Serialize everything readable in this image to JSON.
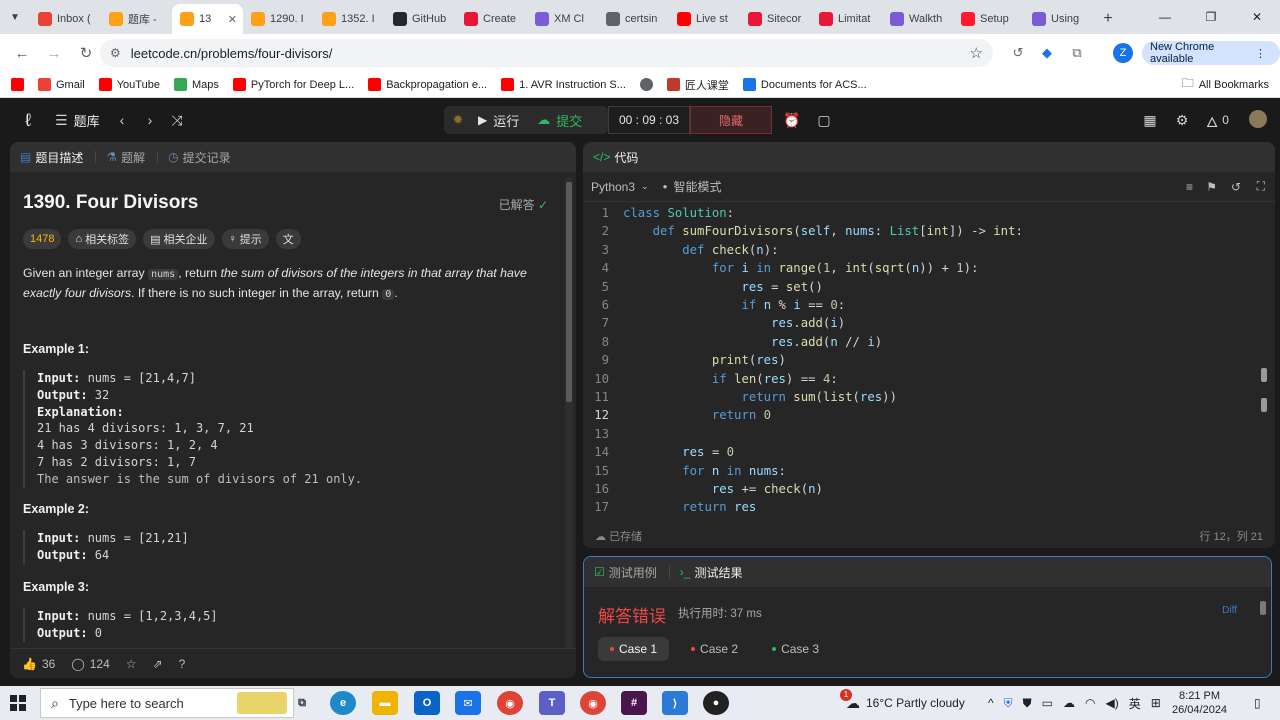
{
  "colors": {
    "accent_blue": "#3d7bbf",
    "difficulty": "#ffb800",
    "error_red": "#ef4743",
    "submit_green": "#2cbb5d"
  },
  "browser": {
    "tabs": [
      {
        "label": "Inbox (",
        "icon": "gmail-icon"
      },
      {
        "label": "题库 -",
        "icon": "leetcode-icon"
      },
      {
        "label": "13",
        "icon": "leetcode-icon",
        "active": true
      },
      {
        "label": "1290. I",
        "icon": "leetcode-icon"
      },
      {
        "label": "1352. I",
        "icon": "leetcode-icon"
      },
      {
        "label": "GitHub",
        "icon": "github-icon"
      },
      {
        "label": "Create",
        "icon": "xp-icon"
      },
      {
        "label": "XM Cl",
        "icon": "xm-icon"
      },
      {
        "label": "certsin",
        "icon": "globe-icon"
      },
      {
        "label": "Live st",
        "icon": "youtube-icon"
      },
      {
        "label": "Sitecor",
        "icon": "xp-icon"
      },
      {
        "label": "Limitat",
        "icon": "xp-icon"
      },
      {
        "label": "Walkth",
        "icon": "xm-icon"
      },
      {
        "label": "Setup",
        "icon": "opera-icon"
      },
      {
        "label": "Using",
        "icon": "xm-icon"
      }
    ],
    "new_tab_label": "+",
    "url": "leetcode.cn/problems/four-divisors/",
    "new_chrome_label": "New Chrome available",
    "profile_initial": "Z",
    "bookmarks": [
      {
        "label": "",
        "icon": "youtube-icon"
      },
      {
        "label": "Gmail",
        "icon": "gmail-icon"
      },
      {
        "label": "YouTube",
        "icon": "youtube-icon"
      },
      {
        "label": "Maps",
        "icon": "maps-icon"
      },
      {
        "label": "PyTorch for Deep L...",
        "icon": "youtube-icon"
      },
      {
        "label": "Backpropagation e...",
        "icon": "youtube-icon"
      },
      {
        "label": "1. AVR Instruction S...",
        "icon": "youtube-icon"
      },
      {
        "label": "",
        "icon": "globe-icon"
      },
      {
        "label": "匠人课堂",
        "icon": "craft-icon"
      },
      {
        "label": "Documents for ACS...",
        "icon": "docs-icon"
      }
    ],
    "all_bookmarks_label": "All Bookmarks"
  },
  "lc_nav": {
    "problem_list_label": "题库",
    "run_label": "运行",
    "submit_label": "提交",
    "timer": "00 : 09 : 03",
    "hide_label": "隐藏",
    "points": "0"
  },
  "description": {
    "tabs": [
      {
        "label": "题目描述",
        "icon": "description-icon",
        "active": true
      },
      {
        "label": "题解",
        "icon": "flask-icon"
      },
      {
        "label": "提交记录",
        "icon": "history-icon"
      }
    ],
    "title": "1390. Four Divisors",
    "solved_label": "已解答",
    "difficulty_value": "1478",
    "tags": [
      "相关标签",
      "相关企业",
      "提示"
    ],
    "statement": {
      "p1": "Given an integer array ",
      "code1": "nums",
      "p2": ", return ",
      "em1": "the sum of divisors of the integers in that array that have exactly four divisors",
      "p3": ". If there is no such integer in the array, return ",
      "code2": "0",
      "p4": "."
    },
    "examples": [
      {
        "title": "Example 1:",
        "input_label": "Input:",
        "input": " nums = [21,4,7]",
        "output_label": "Output:",
        "output": " 32",
        "explanation_label": "Explanation:",
        "explanation": [
          "21 has 4 divisors: 1, 3, 7, 21",
          "4 has 3 divisors: 1, 2, 4",
          "7 has 2 divisors: 1, 7",
          "The answer is the sum of divisors of 21 only."
        ]
      },
      {
        "title": "Example 2:",
        "input_label": "Input:",
        "input": " nums = [21,21]",
        "output_label": "Output:",
        "output": " 64"
      },
      {
        "title": "Example 3:",
        "input_label": "Input:",
        "input": " nums = [1,2,3,4,5]",
        "output_label": "Output:",
        "output": " 0"
      }
    ],
    "footer": {
      "likes": "36",
      "comments": "124"
    }
  },
  "editor": {
    "header_label": "代码",
    "language": "Python3",
    "mode": "智能模式",
    "current_line": 12,
    "lines": [
      "class Solution:",
      "    def sumFourDivisors(self, nums: List[int]) -> int:",
      "        def check(n):",
      "            for i in range(1, int(sqrt(n)) + 1):",
      "                res = set()",
      "                if n % i == 0:",
      "                    res.add(i)",
      "                    res.add(n // i)",
      "            print(res)",
      "            if len(res) == 4:",
      "                return sum(list(res))",
      "            return 0",
      "",
      "        res = 0",
      "        for n in nums:",
      "            res += check(n)",
      "        return res"
    ],
    "saved_label": "已存储",
    "cursor_pos": "行 12，列 21"
  },
  "results": {
    "tabs": [
      {
        "label": "测试用例",
        "icon": "checkbox-icon"
      },
      {
        "label": "测试结果",
        "icon": "terminal-icon",
        "active": true
      }
    ],
    "status": "解答错误",
    "runtime": "执行用时: 37 ms",
    "diff_label": "Diff",
    "cases": [
      {
        "label": "Case 1",
        "status": "error",
        "active": true
      },
      {
        "label": "Case 2",
        "status": "error"
      },
      {
        "label": "Case 3",
        "status": "pass"
      }
    ]
  },
  "taskbar": {
    "search_placeholder": "Type here to search",
    "weather": "16°C  Partly cloudy",
    "weather_badge": "1",
    "ime": "英",
    "time": "8:21 PM",
    "date": "26/04/2024"
  }
}
